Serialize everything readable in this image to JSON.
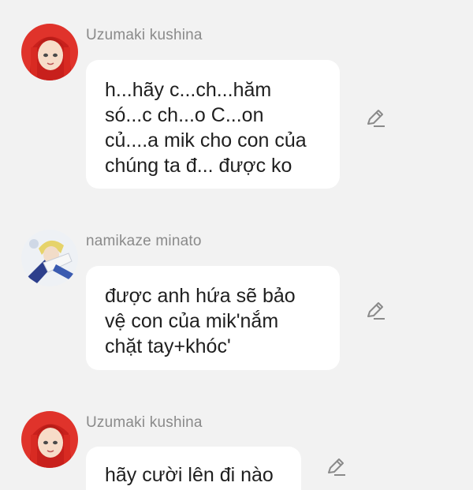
{
  "messages": [
    {
      "sender": "Uzumaki kushina",
      "avatar": "kushina-avatar",
      "text": "h...hãy c...ch...hăm\nsó...c ch...o C...on\ncủ....a mik cho con của\nchúng ta đ... được ko",
      "action_icon": "edit-icon"
    },
    {
      "sender": "namikaze minato",
      "avatar": "minato-avatar",
      "text": "được anh hứa sẽ bảo\nvệ con của mik'nắm\nchặt tay+khóc'",
      "action_icon": "edit-icon"
    },
    {
      "sender": "Uzumaki kushina",
      "avatar": "kushina-avatar",
      "text": "hãy cười lên đi nào",
      "action_icon": "edit-icon"
    }
  ],
  "colors": {
    "background": "#f2f2f2",
    "bubble": "#ffffff",
    "sender_text": "#8a8a8a",
    "message_text": "#1f1f1f",
    "icon": "#8a8a8a"
  }
}
